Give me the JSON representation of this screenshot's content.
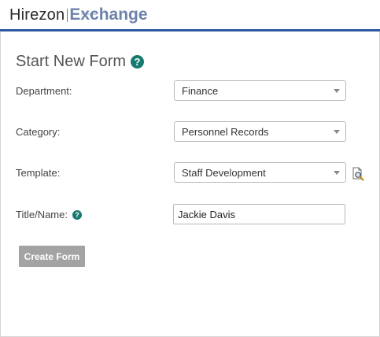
{
  "header": {
    "logo_main": "Hirezon",
    "logo_sub": "Exchange",
    "logo_sub_tiny": "Enterprise"
  },
  "form": {
    "title": "Start New Form",
    "department": {
      "label": "Department:",
      "value": "Finance"
    },
    "category": {
      "label": "Category:",
      "value": "Personnel Records"
    },
    "template": {
      "label": "Template:",
      "value": "Staff Development"
    },
    "title_name": {
      "label": "Title/Name:",
      "value": "Jackie Davis"
    },
    "submit_label": "Create Form"
  },
  "icons": {
    "help": "help-circle-icon",
    "preview": "document-magnifier-icon",
    "dropdown": "chevron-down-icon"
  },
  "colors": {
    "accent": "#2d5aa0",
    "help_icon": "#177a70",
    "logo_sub": "#6d83aa",
    "button_bg": "#a3a3a3"
  }
}
